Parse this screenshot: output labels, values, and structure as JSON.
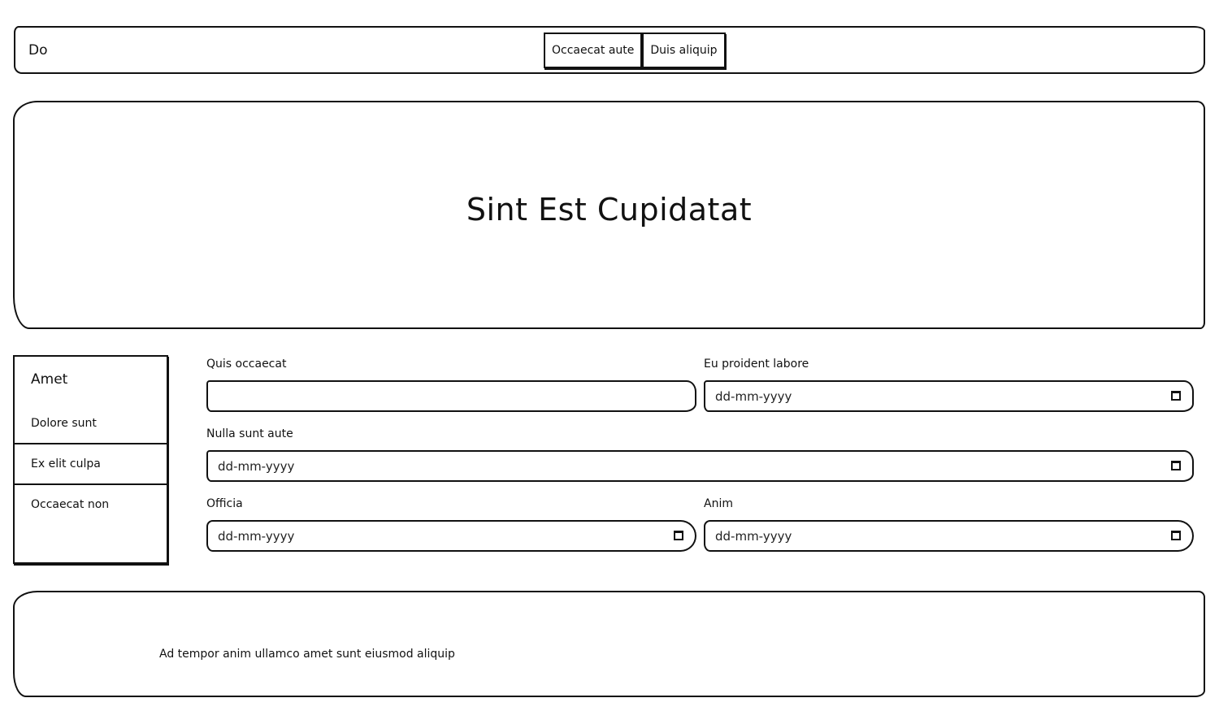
{
  "header": {
    "brand": "Do",
    "nav": [
      "Occaecat aute",
      "Duis aliquip"
    ]
  },
  "hero": {
    "title": "Sint Est Cupidatat"
  },
  "sidebar": {
    "title": "Amet",
    "items": [
      "Dolore sunt",
      "Ex elit culpa",
      "Occaecat non"
    ]
  },
  "form": {
    "fields": [
      {
        "label": "Quis occaecat",
        "value": ""
      },
      {
        "label": "Eu proident labore",
        "placeholder": "dd-mm-yyyy"
      },
      {
        "label": "Nulla sunt aute",
        "placeholder": "dd-mm-yyyy"
      },
      {
        "label": "Officia",
        "placeholder": "dd-mm-yyyy"
      },
      {
        "label": "Anim",
        "placeholder": "dd-mm-yyyy"
      }
    ],
    "calendar_icon": "calendar-icon"
  },
  "footer": {
    "text": "Ad tempor anim ullamco amet sunt eiusmod aliquip"
  }
}
